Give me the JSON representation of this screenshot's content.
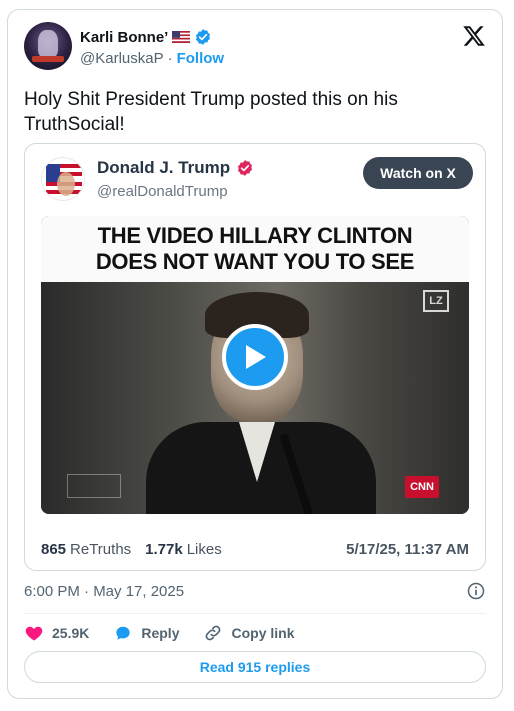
{
  "author": {
    "display_name": "Karli Bonne’",
    "handle": "@KarluskaP",
    "separator": "·",
    "follow_label": "Follow",
    "verified_color": "#1d9bf0"
  },
  "tweet": {
    "text": "Holy Shit President Trump posted this on his TruthSocial!",
    "time": "6:00 PM · May 17, 2025"
  },
  "quote": {
    "display_name": "Donald J. Trump",
    "handle": "@realDonaldTrump",
    "watch_label": "Watch on X",
    "video_headline_line1": "THE VIDEO HILLARY CLINTON",
    "video_headline_line2": "DOES NOT WANT YOU TO SEE",
    "badge_lz": "LZ",
    "badge_cnn": "CNN",
    "retruths_count": "865",
    "retruths_label": "ReTruths",
    "likes_count": "1.77k",
    "likes_label": "Likes",
    "posted_at": "5/17/25, 11:37 AM",
    "verified_color": "#e0245e"
  },
  "actions": {
    "like_count": "25.9K",
    "reply_label": "Reply",
    "copy_link_label": "Copy link",
    "read_replies_label": "Read 915 replies"
  },
  "colors": {
    "accent": "#1d9bf0",
    "like": "#f91880",
    "border": "#cfd9de",
    "secondary_text": "#536471"
  }
}
